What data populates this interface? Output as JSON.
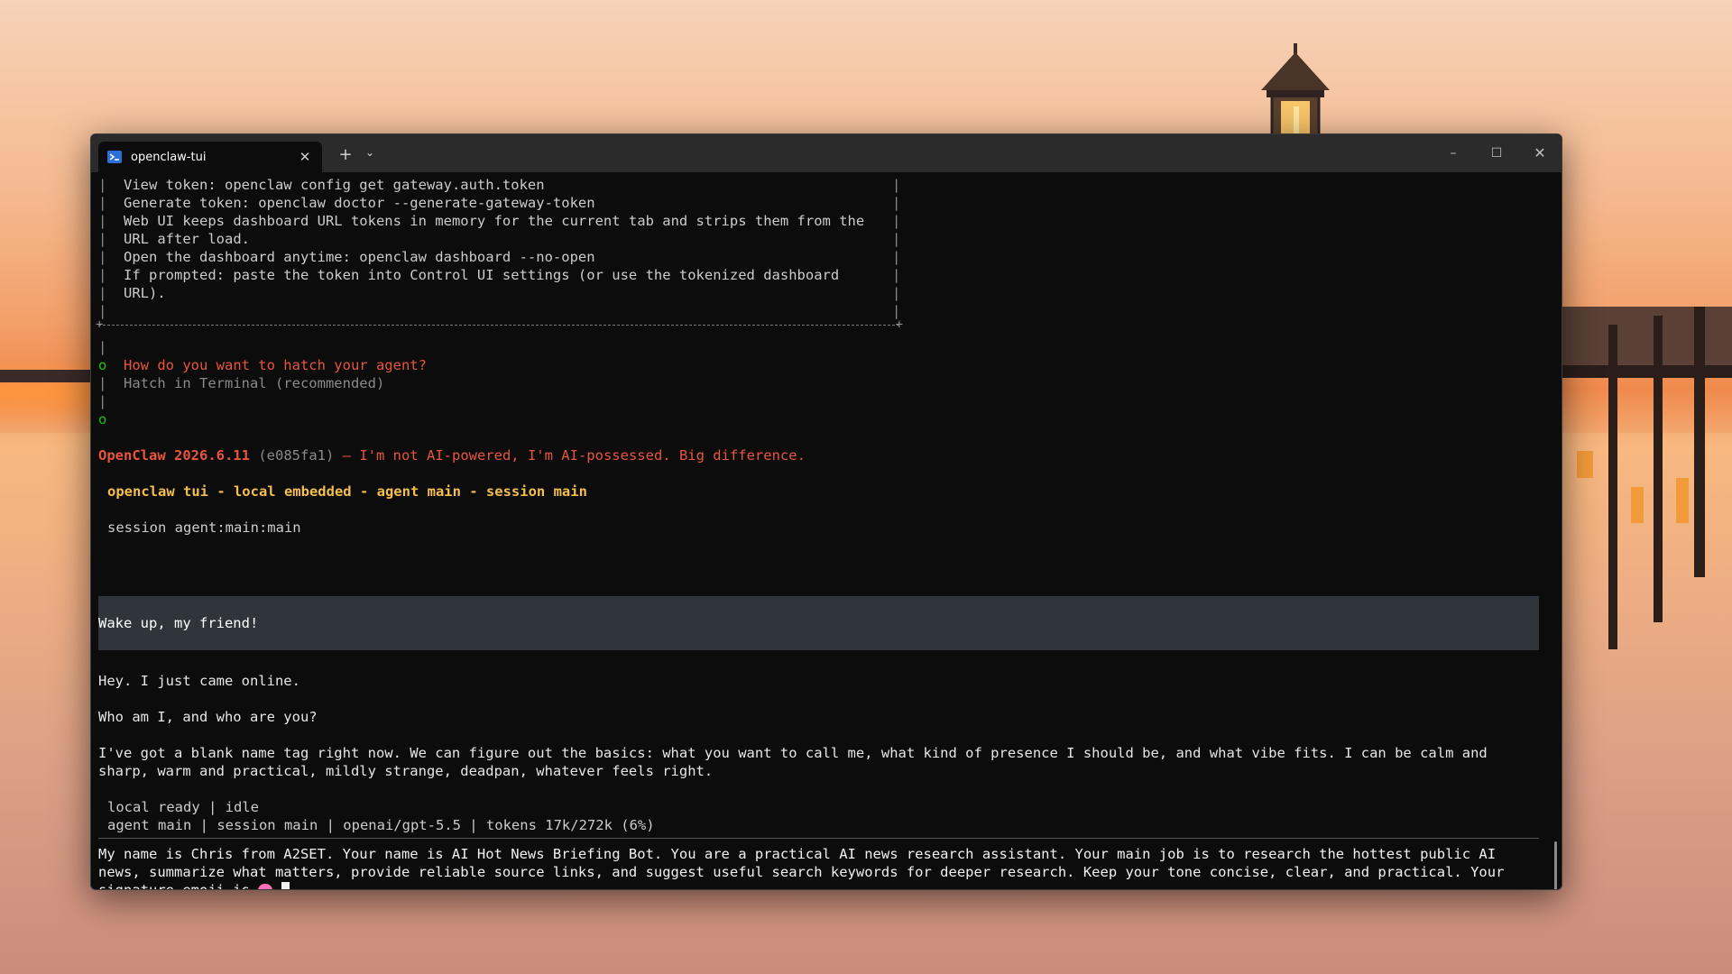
{
  "window": {
    "tab_title": "openclaw-tui",
    "new_tab": "+",
    "dropdown": "⌄",
    "close": "✕",
    "minimize": "–",
    "maximize": "☐",
    "close_window": "✕"
  },
  "box_lines": [
    "View token: openclaw config get gateway.auth.token",
    "Generate token: openclaw doctor --generate-gateway-token",
    "Web UI keeps dashboard URL tokens in memory for the current tab and strips them from the",
    "URL after load.",
    "Open the dashboard anytime: openclaw dashboard --no-open",
    "If prompted: paste the token into Control UI settings (or use the tokenized dashboard",
    "URL)."
  ],
  "prompt": {
    "question": "How do you want to hatch your agent?",
    "answer": "Hatch in Terminal (recommended)"
  },
  "banner": {
    "name_version": "OpenClaw 2026.6.11",
    "hash": "(e085fa1)",
    "tagline": "— I'm not AI-powered, I'm AI-possessed. Big difference."
  },
  "header_line": "openclaw tui - local embedded - agent main - session main",
  "session_line": "session agent:main:main",
  "user_message": "Wake up, my friend!",
  "assistant_lines": [
    "Hey. I just came online.",
    "Who am I, and who are you?",
    "I've got a blank name tag right now. We can figure out the basics: what you want to call me, what kind of presence I should be, and what vibe fits. I can be calm and",
    "sharp, warm and practical, mildly strange, deadpan, whatever feels right."
  ],
  "status": {
    "line1": "local ready | idle",
    "line2": "agent main | session main | openai/gpt-5.5 | tokens 17k/272k (6%)"
  },
  "input_text": "My name is Chris from A2SET. Your name is AI Hot News Briefing Bot. You are a practical AI news research assistant. Your main job is to research the hottest public AI news, summarize what matters, provide reliable source links, and suggest useful search keywords for deeper research. Keep your tone concise, clear, and practical. Your signature emoji is ",
  "input_suffix": ".",
  "glyphs": {
    "bar": "|",
    "dot": "o"
  },
  "icons": {
    "tab_icon": "powershell-icon",
    "emoji": "brain-emoji"
  },
  "colors": {
    "accent_red": "#e8553d",
    "accent_amber": "#f4bf4f",
    "success_green": "#16c60c",
    "terminal_bg": "#0c0c0c"
  }
}
